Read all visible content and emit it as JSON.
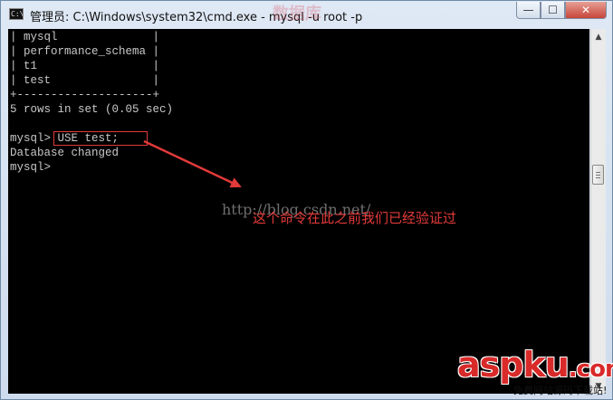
{
  "window": {
    "title": "管理员: C:\\Windows\\system32\\cmd.exe - mysql  -u root -p",
    "icon_label": "C:\\",
    "controls": {
      "minimize": "—",
      "maximize": "☐",
      "close": "✕"
    },
    "watermark_top": "数据库"
  },
  "console": {
    "lines": [
      "| mysql              |",
      "| performance_schema |",
      "| t1                 |",
      "| test               |",
      "+--------------------+",
      "5 rows in set (0.05 sec)",
      "",
      "mysql> USE test;",
      "Database changed",
      "mysql>"
    ]
  },
  "annotation": {
    "text": "这个命令在此之前我们已经验证过",
    "color": "#e23a3a"
  },
  "watermark": {
    "url": "http://blog.csdn.net/",
    "brand": "aspku",
    "brand_suffix": ".com",
    "sub": "免费网站源码下载站!"
  },
  "scrollbar": {
    "up": "▲",
    "down": "▼"
  },
  "colors": {
    "console_bg": "#000000",
    "console_fg": "#c8c8c8",
    "accent": "#e23a3a"
  }
}
